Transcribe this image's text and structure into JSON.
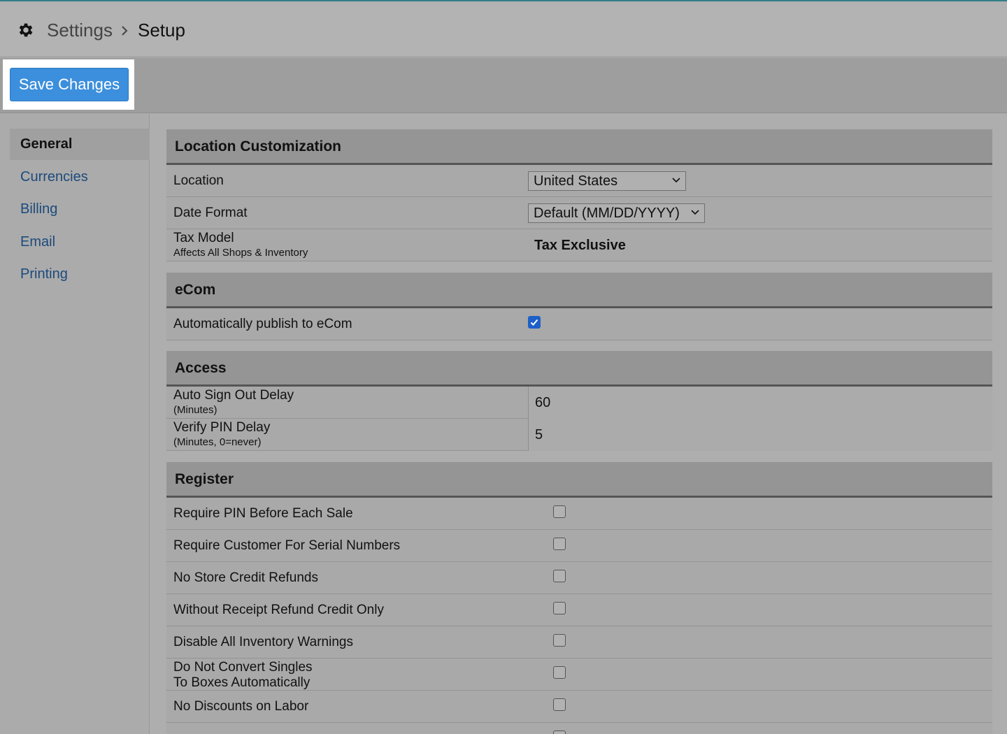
{
  "breadcrumb": {
    "parent": "Settings",
    "current": "Setup"
  },
  "toolbar": {
    "save_label": "Save Changes"
  },
  "sidebar": {
    "items": [
      {
        "label": "General",
        "active": true
      },
      {
        "label": "Currencies"
      },
      {
        "label": "Billing"
      },
      {
        "label": "Email"
      },
      {
        "label": "Printing"
      }
    ]
  },
  "sections": {
    "location": {
      "title": "Location Customization",
      "location_label": "Location",
      "location_value": "United States",
      "date_label": "Date Format",
      "date_value": "Default (MM/DD/YYYY)",
      "tax_label": "Tax Model",
      "tax_sub": "Affects All Shops & Inventory",
      "tax_value": "Tax Exclusive"
    },
    "ecom": {
      "title": "eCom",
      "publish_label": "Automatically publish to eCom",
      "publish_checked": true
    },
    "access": {
      "title": "Access",
      "signout_label": "Auto Sign Out Delay",
      "signout_sub": "(Minutes)",
      "signout_value": "60",
      "pin_label": "Verify PIN Delay",
      "pin_sub": "(Minutes, 0=never)",
      "pin_value": "5"
    },
    "register": {
      "title": "Register",
      "items": [
        {
          "label": "Require PIN Before Each Sale",
          "checked": false
        },
        {
          "label": "Require Customer For Serial Numbers",
          "checked": false
        },
        {
          "label": "No Store Credit Refunds",
          "checked": false
        },
        {
          "label": "Without Receipt Refund Credit Only",
          "checked": false
        },
        {
          "label": "Disable All Inventory Warnings",
          "checked": false
        },
        {
          "label": "Do Not Convert Singles",
          "label2": "To Boxes Automatically",
          "checked": false
        },
        {
          "label": "No Discounts on Labor",
          "checked": false
        }
      ]
    }
  },
  "colors": {
    "accent": "#3c8fdc",
    "checkbox_checked": "#1e60c8",
    "link": "#1c4a7c"
  }
}
